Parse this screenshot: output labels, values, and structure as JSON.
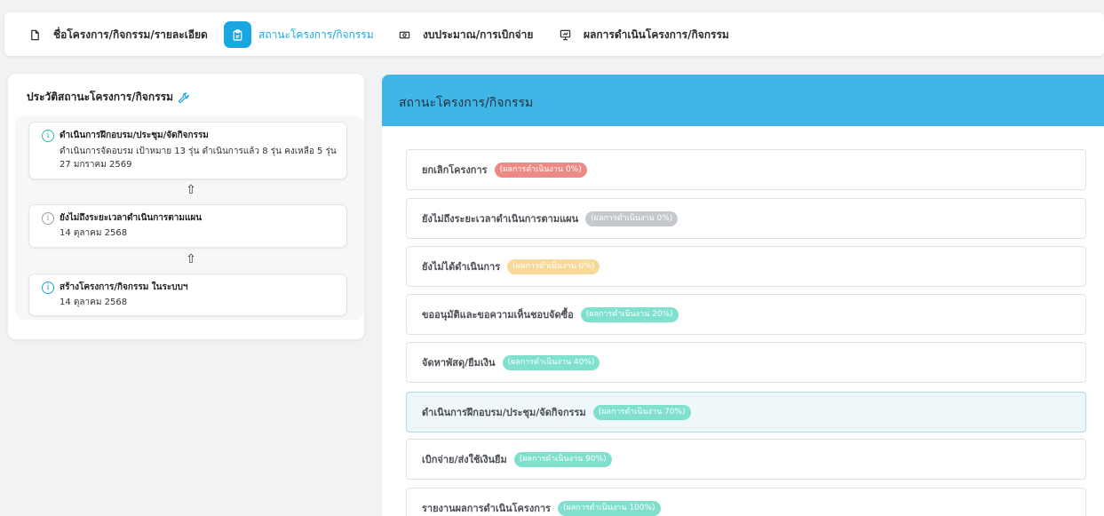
{
  "tabs": [
    {
      "label": "ชื่อโครงการ/กิจกรรม/รายละเอียด",
      "icon": "document-icon",
      "active": false
    },
    {
      "label": "สถานะโครงการ/กิจกรรม",
      "icon": "clipboard-icon",
      "active": true
    },
    {
      "label": "งบประมาณ/การเบิกจ่าย",
      "icon": "money-icon",
      "active": false
    },
    {
      "label": "ผลการดำเนินโครงการ/กิจกรรม",
      "icon": "presentation-icon",
      "active": false
    }
  ],
  "history": {
    "title": "ประวัติสถานะโครงการ/กิจกรรม",
    "icon": "wrench-icon",
    "items": [
      {
        "title": "ดำเนินการฝึกอบรม/ประชุม/จัดกิจกรรม",
        "detail": "ดำเนินการจัดอบรม เป้าหมาย 13 รุ่น ดำเนินการแล้ว 8 รุ่น คงเหลือ 5 รุ่น",
        "date": "27 มกราคม 2569",
        "color": "#2ec4a0"
      },
      {
        "title": "ยังไม่ถึงระยะเวลาดำเนินการตามแผน",
        "detail": "",
        "date": "14 ตุลาคม 2568",
        "color": "#9aa0a6"
      },
      {
        "title": "สร้างโครงการ/กิจกรรม ในระบบฯ",
        "detail": "",
        "date": "14 ตุลาคม 2568",
        "color": "#1aa7e0"
      }
    ]
  },
  "status": {
    "title": "สถานะโครงการ/กิจกรรม",
    "items": [
      {
        "label": "ยกเลิกโครงการ",
        "badge": "(ผลการดำเนินงาน 0%)",
        "color": "#ee8a86"
      },
      {
        "label": "ยังไม่ถึงระยะเวลาดำเนินการตามแผน",
        "badge": "(ผลการดำเนินงาน 0%)",
        "color": "#c5c8cc"
      },
      {
        "label": "ยังไม่ได้ดำเนินการ",
        "badge": "(ผลการดำเนินงาน 0%)",
        "color": "#f7d99a"
      },
      {
        "label": "ขออนุมัติและขอความเห็นชอบจัดซื้อ",
        "badge": "(ผลการดำเนินงาน 20%)",
        "color": "#7fe0cd"
      },
      {
        "label": "จัดหาพัสดุ/ยืมเงิน",
        "badge": "(ผลการดำเนินงาน 40%)",
        "color": "#7fe0cd"
      },
      {
        "label": "ดำเนินการฝึกอบรม/ประชุม/จัดกิจกรรม",
        "badge": "(ผลการดำเนินงาน 70%)",
        "color": "#7fe0cd",
        "current": true
      },
      {
        "label": "เบิกจ่าย/ส่งใช้เงินยืม",
        "badge": "(ผลการดำเนินงาน 90%)",
        "color": "#7fe0cd"
      },
      {
        "label": "รายงานผลการดำเนินโครงการ",
        "badge": "(ผลการดำเนินงาน 100%)",
        "color": "#7fe0cd"
      }
    ]
  }
}
